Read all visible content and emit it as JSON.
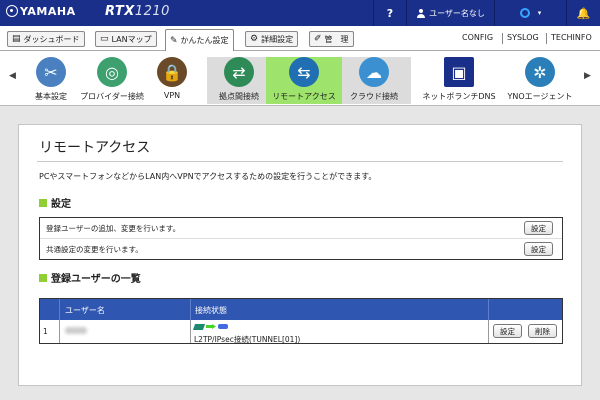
{
  "header": {
    "brand": "YAMAHA",
    "model_prefix": "RTX",
    "model_number": "1210",
    "help_label": "?",
    "user_label": "ユーザー名なし",
    "caret": "▾",
    "bell": "🔔"
  },
  "nav": {
    "tabs": [
      {
        "label": "ダッシュボード",
        "icon": "▤"
      },
      {
        "label": "LANマップ",
        "icon": "▭"
      },
      {
        "label": "かんたん設定",
        "icon": "✎"
      },
      {
        "label": "詳細設定",
        "icon": "⚙"
      },
      {
        "label": "管　理",
        "icon": "✐"
      }
    ],
    "links": [
      "CONFIG",
      "SYSLOG",
      "TECHINFO"
    ]
  },
  "toolbar": {
    "left_arrow": "◀",
    "right_arrow": "▶",
    "items": [
      {
        "label": "基本設定",
        "glyph": "✂",
        "color": "#4a7fc0"
      },
      {
        "label": "プロバイダー接続",
        "glyph": "◎",
        "color": "#3ea06e"
      },
      {
        "label": "VPN",
        "glyph": "🔒",
        "color": "#6b4a2a"
      },
      {
        "label": "拠点間接続",
        "glyph": "⇄",
        "color": "#2e8b57"
      },
      {
        "label": "リモートアクセス",
        "glyph": "⇆",
        "color": "#1f6fb2"
      },
      {
        "label": "クラウド接続",
        "glyph": "☁",
        "color": "#3a90d0"
      },
      {
        "label": "ネットボランチDNS",
        "glyph": "▣",
        "color": "#1a2f8a"
      },
      {
        "label": "YNOエージェント",
        "glyph": "✲",
        "color": "#2b7fb8"
      }
    ]
  },
  "panel": {
    "title": "リモートアクセス",
    "description": "PCやスマートフォンなどからLAN内へVPNでアクセスするための設定を行うことができます。",
    "settings_section": "設定",
    "settings_rows": [
      {
        "text": "登録ユーザーの追加、変更を行います。",
        "button": "設定"
      },
      {
        "text": "共通設定の変更を行います。",
        "button": "設定"
      }
    ],
    "users_section": "登録ユーザーの一覧",
    "users_table": {
      "headers": [
        "ユーザー名",
        "接続状態"
      ],
      "rows": [
        {
          "index": "1",
          "status": "L2TP/IPsec接続(TUNNEL[01])",
          "edit": "設定",
          "delete": "削除"
        }
      ]
    }
  }
}
